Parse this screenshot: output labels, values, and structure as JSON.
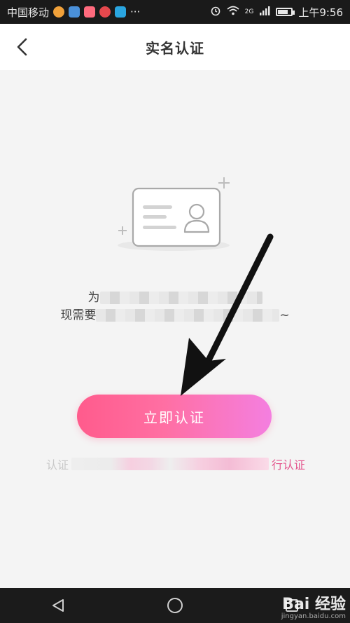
{
  "status_bar": {
    "carrier": "中国移动",
    "time": "上午9:56",
    "more": "···",
    "network": "2G",
    "icons": [
      "alarm-icon",
      "wifi-icon",
      "signal-icon",
      "battery-icon"
    ]
  },
  "header": {
    "title": "实名认证",
    "back_icon": "chevron-left-icon"
  },
  "notice": {
    "line1_start": "为",
    "line2_start": "现需要",
    "line2_end": "~"
  },
  "primary_button": {
    "label": "立即认证"
  },
  "secondary_note": {
    "start": "认证",
    "end": "行认证"
  },
  "nav": {
    "back": "triangle-back-icon",
    "home": "circle-home-icon",
    "recents": "square-recents-icon"
  },
  "watermark": {
    "brand": "Bai 经验",
    "url": "jingyan.baidu.com"
  },
  "colors": {
    "accent": "#ff5b8c",
    "accent_end": "#f47fe0",
    "link": "#e4558d"
  }
}
